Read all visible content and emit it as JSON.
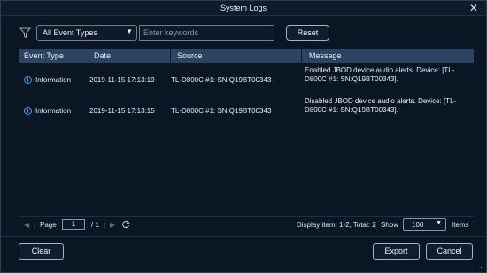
{
  "window": {
    "title": "System Logs",
    "close_glyph": "✕"
  },
  "toolbar": {
    "filter_icon": "funnel-icon",
    "event_type_selected": "All Event Types",
    "search_placeholder": "Enter keywords",
    "search_value": "",
    "reset_label": "Reset"
  },
  "table": {
    "columns": [
      "Event Type",
      "Date",
      "Source",
      "Message"
    ],
    "rows": [
      {
        "event_type": "Information",
        "date": "2019-11-15 17:13:19",
        "source": "TL-D800C #1: SN:Q19BT00343",
        "message_line1": "Enabled JBOD device audio alerts. Device: [TL-",
        "message_line2": "D800C #1: SN:Q19BT00343]."
      },
      {
        "event_type": "Information",
        "date": "2019-11-15 17:13:15",
        "source": "TL-D800C #1: SN:Q19BT00343",
        "message_line1": "Disabled JBOD device audio alerts. Device: [TL-",
        "message_line2": "D800C #1: SN:Q19BT00343]."
      }
    ]
  },
  "pager": {
    "page_label": "Page",
    "page_value": "1",
    "total_pages": "/ 1",
    "display_info": "Display item: 1-2, Total: 2",
    "show_label": "Show",
    "show_value": "100",
    "items_label": "Items"
  },
  "footer": {
    "clear_label": "Clear",
    "export_label": "Export",
    "cancel_label": "Cancel"
  },
  "colors": {
    "background": "#0a1624",
    "header_row": "#2b4461",
    "info_icon": "#3fa1f0"
  }
}
